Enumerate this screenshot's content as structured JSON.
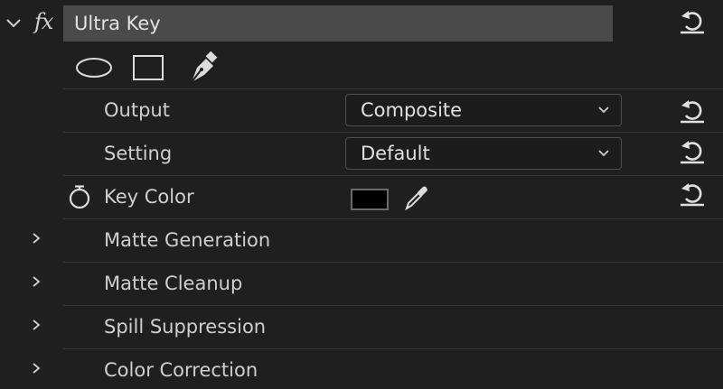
{
  "effect": {
    "name": "Ultra Key",
    "fx_label": "fx"
  },
  "mask_tools": [
    "ellipse-mask-icon",
    "rectangle-mask-icon",
    "pen-mask-icon"
  ],
  "properties": {
    "output": {
      "label": "Output",
      "value": "Composite"
    },
    "setting": {
      "label": "Setting",
      "value": "Default"
    },
    "key_color": {
      "label": "Key Color",
      "color": "#000000"
    }
  },
  "groups": [
    {
      "label": "Matte Generation"
    },
    {
      "label": "Matte Cleanup"
    },
    {
      "label": "Spill Suppression"
    },
    {
      "label": "Color Correction"
    }
  ],
  "colors": {
    "background": "#1f1f1f",
    "name_bar": "#4a4a4a",
    "text": "#cfcfcf"
  }
}
